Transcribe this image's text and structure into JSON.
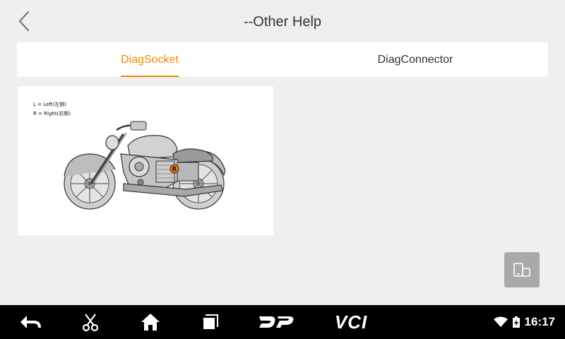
{
  "header": {
    "title": "--Other Help",
    "back_icon": "chevron-left-icon"
  },
  "tabs": [
    {
      "label": "DiagSocket",
      "active": true
    },
    {
      "label": "DiagConnector",
      "active": false
    }
  ],
  "card": {
    "legend": [
      "L = Left(左侧)",
      "R = Right(右侧)"
    ],
    "marker_label": "R"
  },
  "fab_icon": "switch-view-icon",
  "navbar": {
    "buttons": [
      "back-arrow-icon",
      "scissors-icon",
      "home-icon",
      "recents-icon",
      "dp-logo",
      "vci-logo"
    ],
    "dp_label": "DP",
    "vci_label": "VCI",
    "time": "16:17"
  },
  "colors": {
    "accent": "#f08a00",
    "background": "#efefef",
    "navbar": "#000000",
    "fab": "#a9a9a9"
  }
}
